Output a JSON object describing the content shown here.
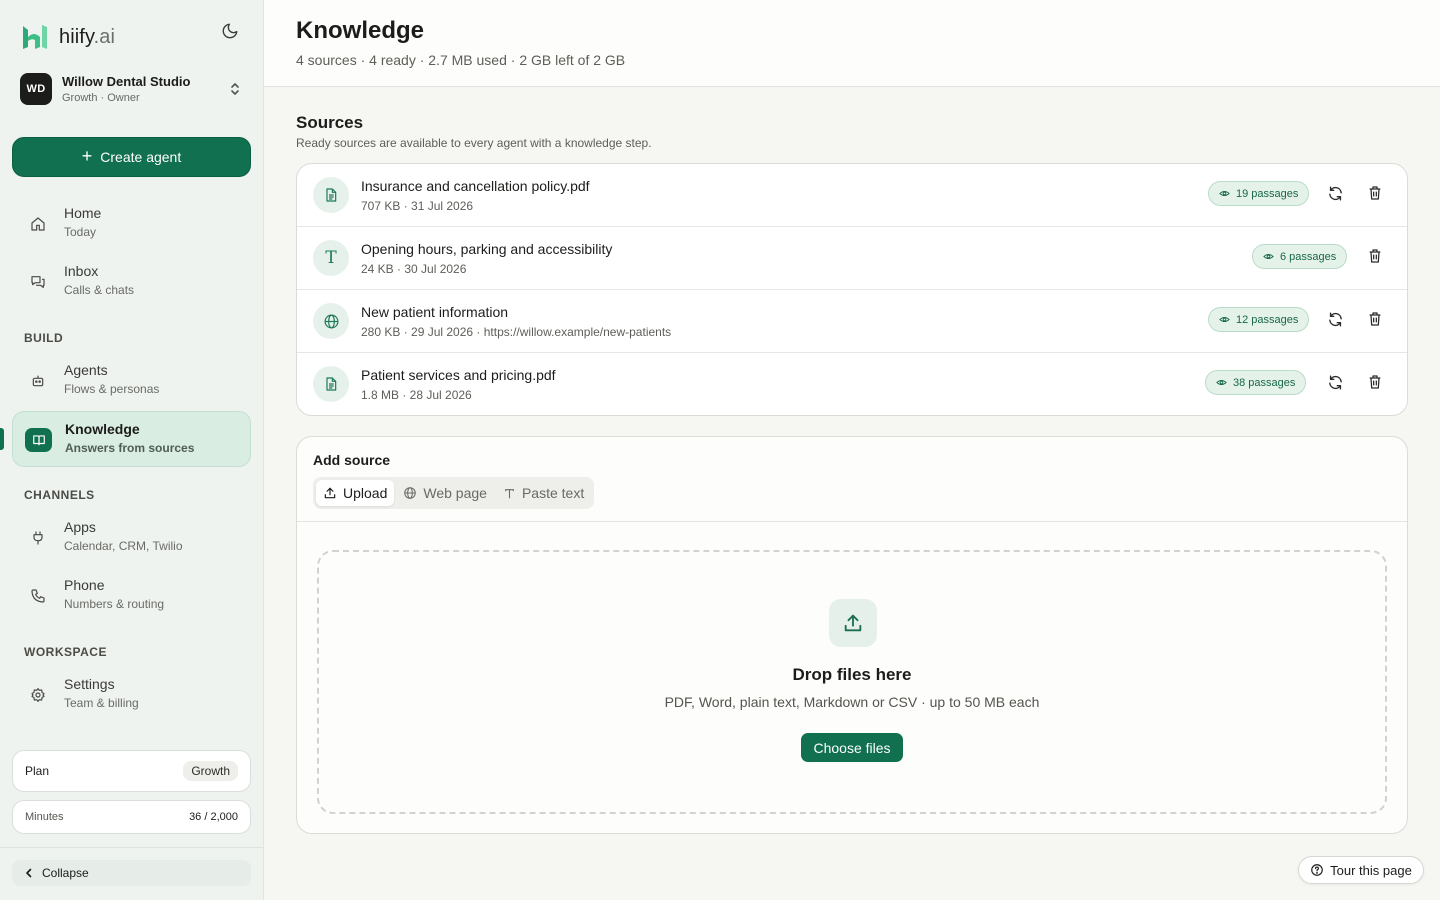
{
  "brand": {
    "name_main": "hiify",
    "name_suffix": ".ai",
    "accent": "#10704f"
  },
  "workspace": {
    "initials": "WD",
    "name": "Willow Dental Studio",
    "subtitle": "Growth · Owner"
  },
  "create_agent": {
    "label": "Create agent"
  },
  "nav": {
    "home": {
      "title": "Home",
      "sub": "Today",
      "icon": "home-icon"
    },
    "inbox": {
      "title": "Inbox",
      "sub": "Calls & chats",
      "icon": "chat-icon"
    },
    "build_label": "BUILD",
    "agents": {
      "title": "Agents",
      "sub": "Flows & personas",
      "icon": "robot-icon"
    },
    "knowledge": {
      "title": "Knowledge",
      "sub": "Answers from sources",
      "icon": "book-icon"
    },
    "channels_label": "CHANNELS",
    "apps": {
      "title": "Apps",
      "sub": "Calendar, CRM, Twilio",
      "icon": "plug-icon"
    },
    "phone": {
      "title": "Phone",
      "sub": "Numbers & routing",
      "icon": "phone-icon"
    },
    "workspace_label": "WORKSPACE",
    "settings": {
      "title": "Settings",
      "sub": "Team & billing",
      "icon": "gear-icon"
    }
  },
  "plan": {
    "label": "Plan",
    "value": "Growth"
  },
  "minutes": {
    "label": "Minutes",
    "value": "36 / 2,000"
  },
  "collapse": {
    "label": "Collapse"
  },
  "header": {
    "title": "Knowledge",
    "subtitle": "4 sources · 4 ready · 2.7 MB used · 2 GB left of 2 GB"
  },
  "sources": {
    "title": "Sources",
    "subtitle": "Ready sources are available to every agent with a knowledge step.",
    "items": [
      {
        "name": "Insurance and cancellation policy.pdf",
        "meta": "707 KB · 31 Jul 2026",
        "passages": "19 passages",
        "icon": "document-icon",
        "refreshable": true
      },
      {
        "name": "Opening hours, parking and accessibility",
        "meta": "24 KB · 30 Jul 2026",
        "passages": "6 passages",
        "icon": "text-icon",
        "refreshable": false
      },
      {
        "name": "New patient information",
        "meta": "280 KB · 29 Jul 2026 · https://willow.example/new-patients",
        "passages": "12 passages",
        "icon": "globe-icon",
        "refreshable": true
      },
      {
        "name": "Patient services and pricing.pdf",
        "meta": "1.8 MB · 28 Jul 2026",
        "passages": "38 passages",
        "icon": "document-icon",
        "refreshable": true
      }
    ]
  },
  "add_source": {
    "title": "Add source",
    "tabs": [
      {
        "label": "Upload",
        "active": true
      },
      {
        "label": "Web page",
        "active": false
      },
      {
        "label": "Paste text",
        "active": false
      }
    ],
    "drop_title": "Drop files here",
    "drop_sub": "PDF, Word, plain text, Markdown or CSV · up to 50 MB each",
    "choose_label": "Choose files"
  },
  "tour": {
    "label": "Tour this page"
  }
}
